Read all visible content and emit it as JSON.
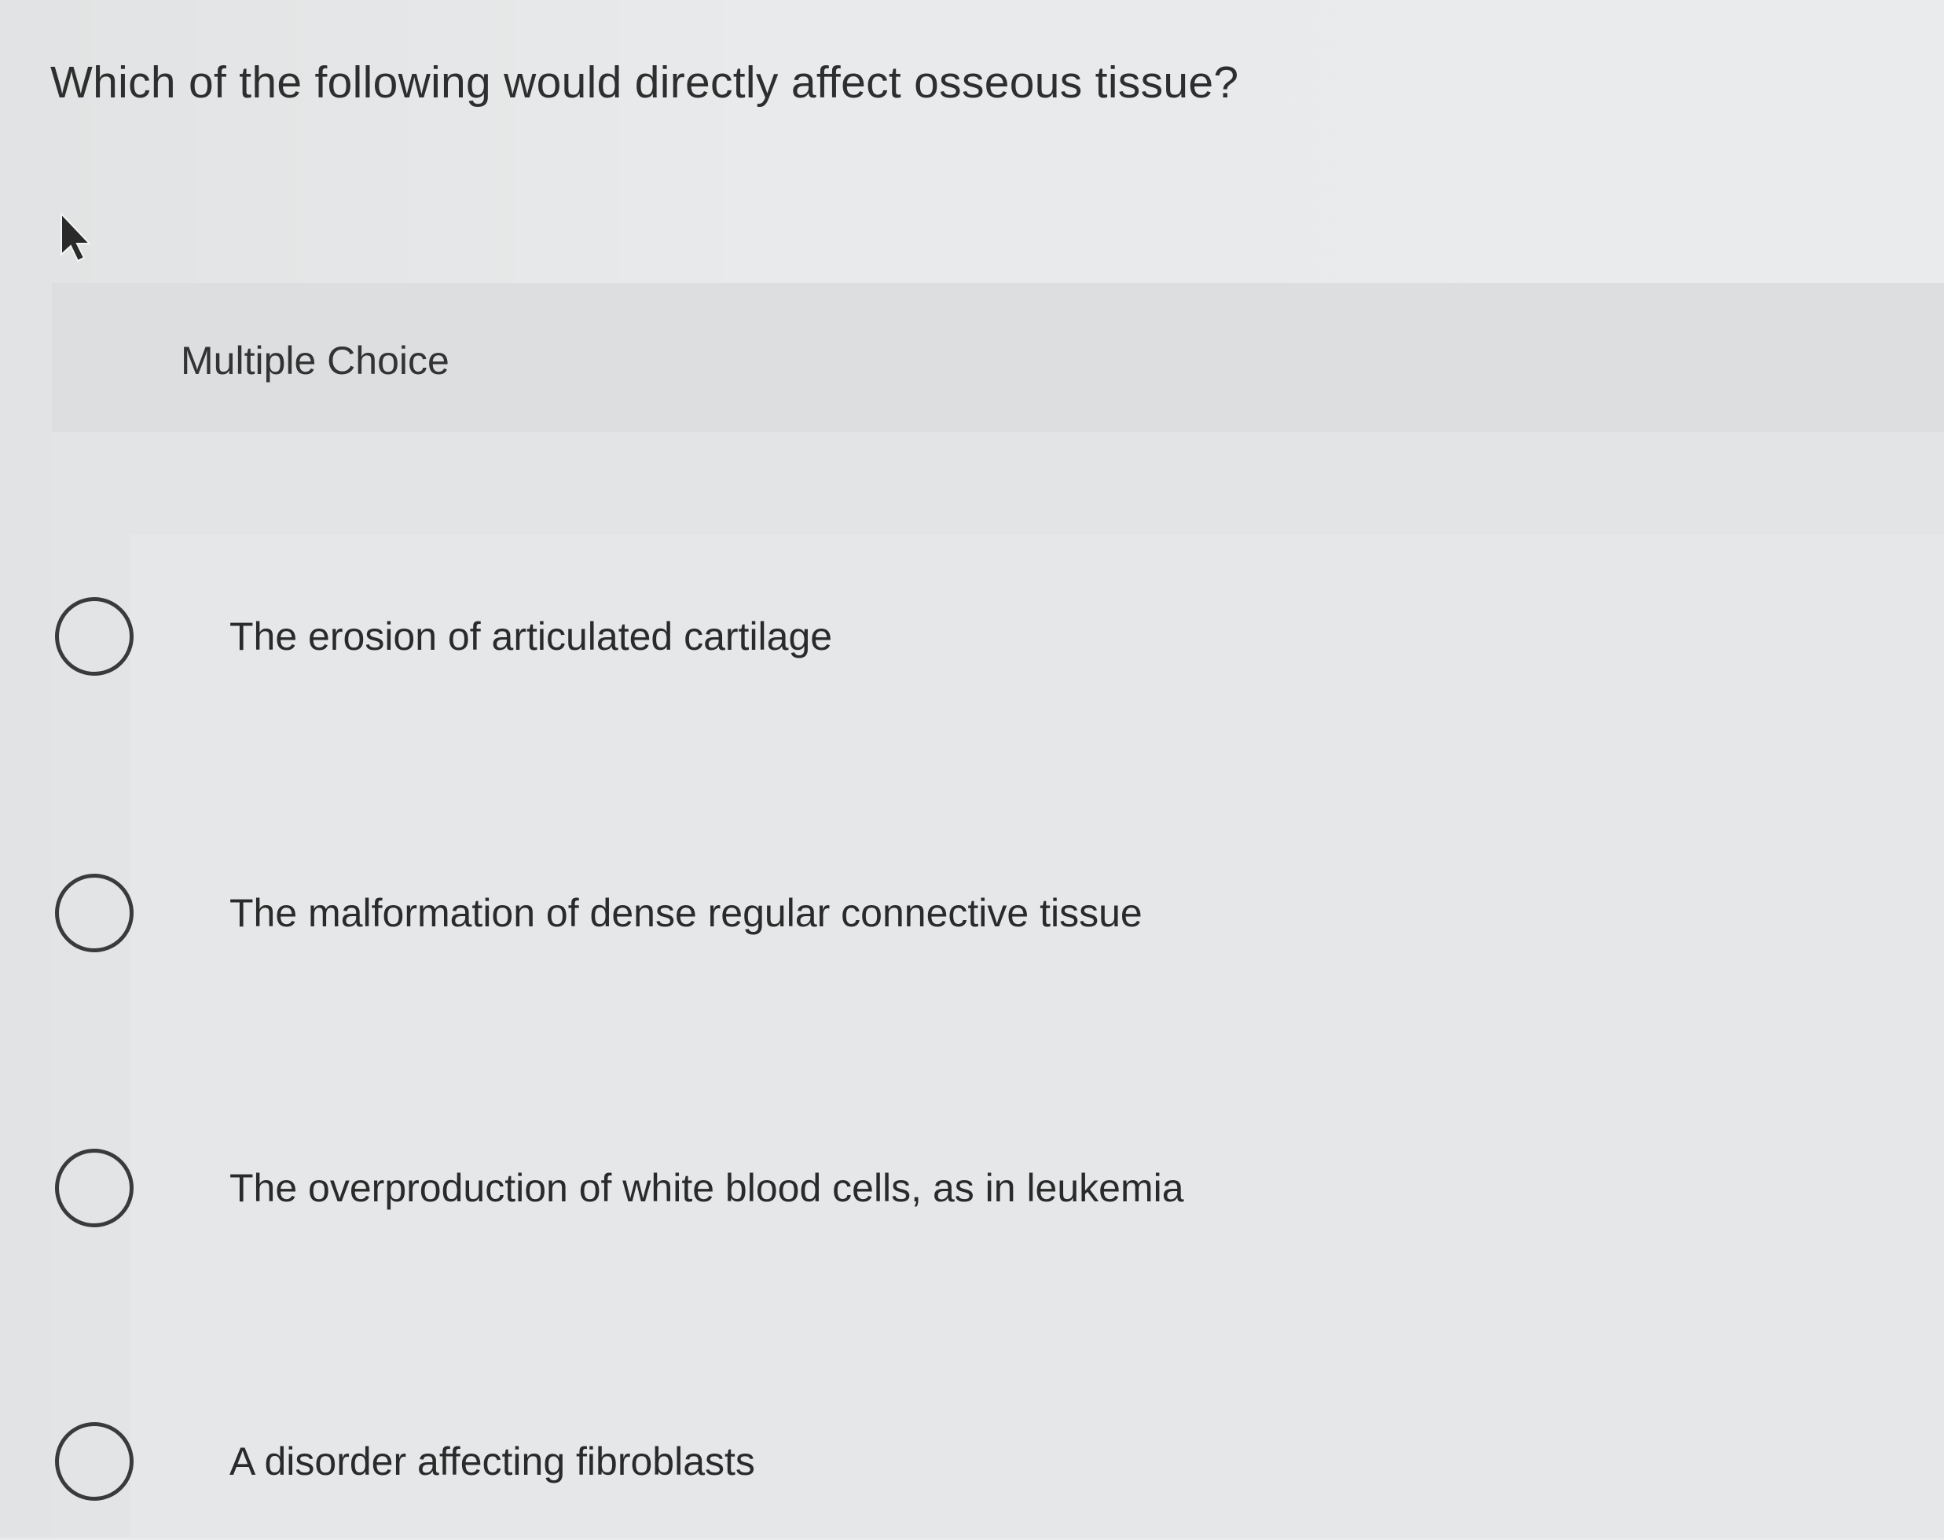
{
  "question": {
    "text": "Which of the following would directly affect osseous tissue?"
  },
  "multiple_choice": {
    "label": "Multiple Choice",
    "options": [
      {
        "label": "The erosion of articulated cartilage",
        "selected": false
      },
      {
        "label": "The malformation of dense regular connective tissue",
        "selected": false
      },
      {
        "label": "The overproduction of white blood cells, as in leukemia",
        "selected": false
      },
      {
        "label": "A disorder affecting fibroblasts",
        "selected": false
      }
    ]
  },
  "icons": {
    "pointer": "mouse-pointer-icon",
    "radio": "radio-unchecked-icon"
  },
  "colors": {
    "background": "#e8eaeb",
    "text": "#2e2e2e",
    "radio_border": "#3a3a3a"
  }
}
